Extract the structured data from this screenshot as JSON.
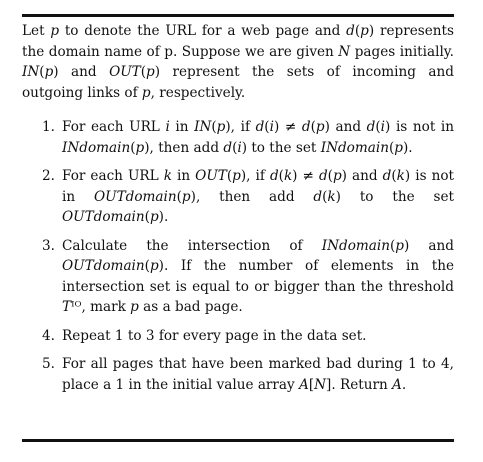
{
  "algorithm": {
    "intro": "Let 𝑝 to denote the URL for a web page and 𝑑(𝑝) represents the domain name of p. Suppose we are given 𝑁 pages initially. 𝐼𝑁(𝑝) and 𝑂𝑈𝑇(𝑝) represent the sets of incoming and outgoing links of 𝑝, respectively.",
    "steps": [
      {
        "number": "1.",
        "text": "For each URL 𝑖 in 𝐼𝑁(𝑝), if 𝑑(𝑖) ≠ 𝑑(𝑝) and 𝑑(𝑖) is not in 𝐼𝑁𝑑𝑜𝑚𝑎𝑖𝑛(𝑝), then add 𝑑(𝑖) to the set 𝐼𝑁𝑑𝑜𝑚𝑎𝑖𝑛(𝑝)."
      },
      {
        "number": "2.",
        "text": "For each URL 𝑘 in 𝑂𝑈𝑇(𝑝), if 𝑑(𝑘) ≠ 𝑑(𝑝) and 𝑑(𝑘) is not in 𝑂𝑈𝑇𝑑𝑜𝑚𝑎𝑖𝑛(𝑝), then add 𝑑(𝑘) to the set 𝑂𝑈𝑇𝑑𝑜𝑚𝑎𝑖𝑛(𝑝)."
      },
      {
        "number": "3.",
        "text": "Calculate the intersection of 𝐼𝑁𝑑𝑜𝑚𝑎𝑖𝑛(𝑝) and 𝑂𝑈𝑇𝑑𝑜𝑚𝑎𝑖𝑛(𝑝). If the number of elements in the intersection set is equal to or bigger than the threshold 𝑇ᴵᴼ, mark 𝑝 as a bad page."
      },
      {
        "number": "4.",
        "text": "Repeat 1 to 3 for every page in the data set."
      },
      {
        "number": "5.",
        "text": "For all pages that have been marked bad during 1 to 4, place a 1 in the initial value array 𝐴[𝑁]. Return 𝐴."
      }
    ]
  }
}
